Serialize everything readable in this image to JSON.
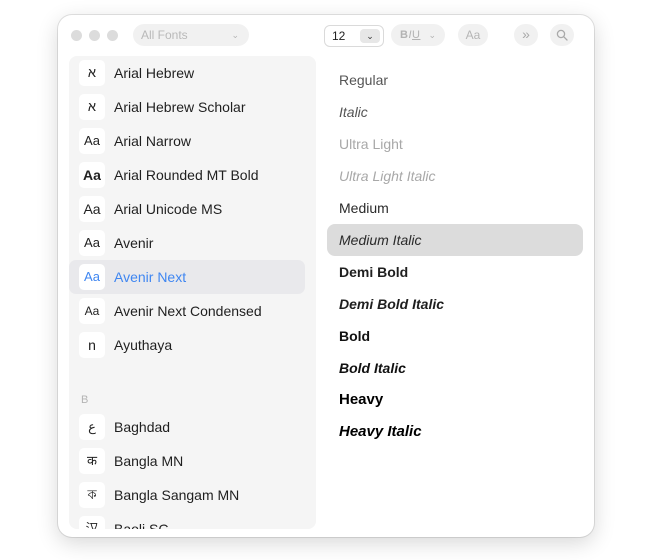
{
  "toolbar": {
    "collection": "All Fonts",
    "collection_chevron": "⌄",
    "size": "12",
    "size_chevron": "⌄",
    "style_buttons": "BIU",
    "style_chevron": "⌄",
    "preview_label": "Aa",
    "more_label": "»",
    "search_icon": "magnifying-glass"
  },
  "sidebar": {
    "items_top": [
      {
        "glyph": "א",
        "name": "Arial Hebrew"
      },
      {
        "glyph": "א",
        "name": "Arial Hebrew Scholar"
      },
      {
        "glyph": "Aa",
        "name": "Arial Narrow"
      },
      {
        "glyph": "Aa",
        "name": "Arial Rounded MT Bold"
      },
      {
        "glyph": "Aa",
        "name": "Arial Unicode MS"
      },
      {
        "glyph": "Aa",
        "name": "Avenir"
      },
      {
        "glyph": "Aa",
        "name": "Avenir Next",
        "selected": true
      },
      {
        "glyph": "Aa",
        "name": "Avenir Next Condensed"
      },
      {
        "glyph": "n",
        "name": "Ayuthaya"
      }
    ],
    "section_b": "B",
    "items_b": [
      {
        "glyph": "ع",
        "name": "Baghdad"
      },
      {
        "glyph": "क",
        "name": "Bangla MN"
      },
      {
        "glyph": "ক",
        "name": "Bangla Sangam MN"
      },
      {
        "glyph": "汉",
        "name": "Baoli SC"
      }
    ]
  },
  "styles": [
    "Regular",
    "Italic",
    "Ultra Light",
    "Ultra Light Italic",
    "Medium",
    "Medium Italic",
    "Demi Bold",
    "Demi Bold Italic",
    "Bold",
    "Bold Italic",
    "Heavy",
    "Heavy Italic"
  ],
  "selected_style": "Medium Italic",
  "colors": {
    "accent": "#3f86f1",
    "sidebar_bg": "#f5f5f5",
    "selected_style_bg": "#dcdcdc"
  }
}
